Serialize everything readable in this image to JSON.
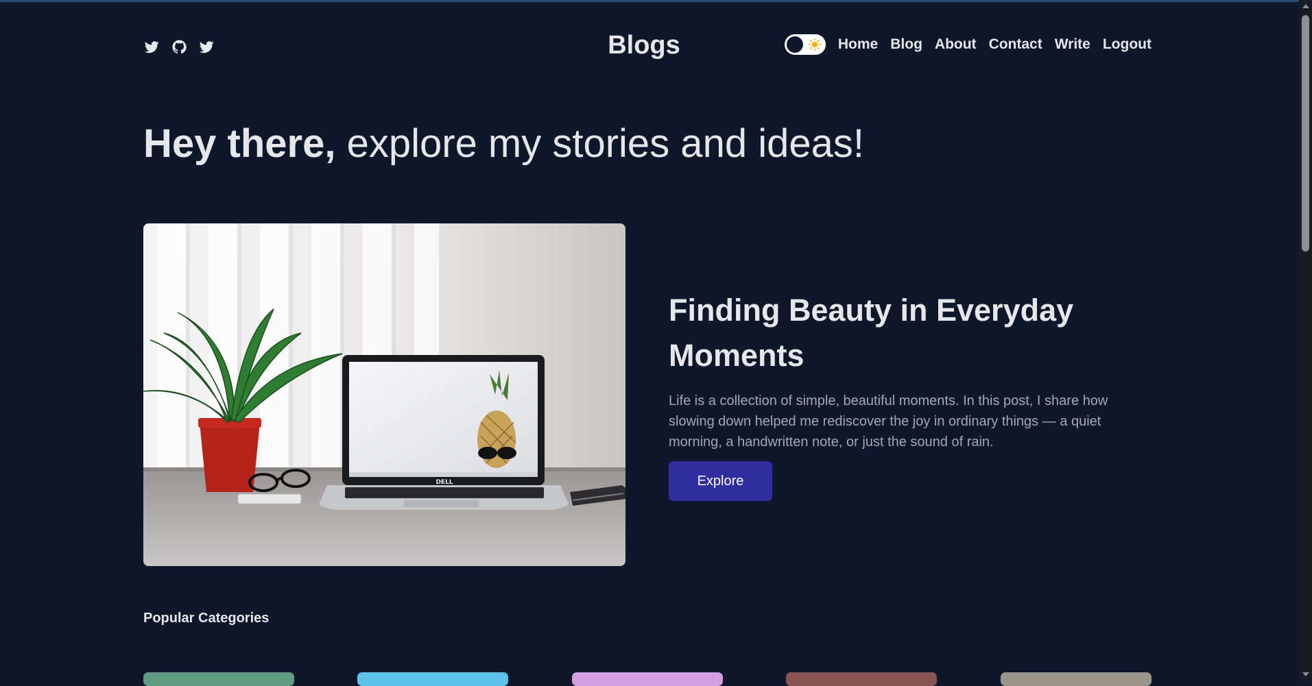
{
  "header": {
    "brand": "Blogs",
    "socials": [
      "twitter-icon",
      "github-icon",
      "twitter-icon"
    ],
    "theme_toggle": {
      "state": "dark",
      "icon": "sun-icon"
    },
    "nav": [
      {
        "label": "Home"
      },
      {
        "label": "Blog"
      },
      {
        "label": "About"
      },
      {
        "label": "Contact"
      },
      {
        "label": "Write"
      },
      {
        "label": "Logout"
      }
    ]
  },
  "hero": {
    "bold": "Hey there,",
    "light": "explore my stories and ideas!"
  },
  "featured": {
    "title": "Finding Beauty in Everyday Moments",
    "description": "Life is a collection of simple, beautiful moments. In this post, I share how slowing down helped me rediscover the joy in ordinary things — a quiet morning, a handwritten note, or just the sound of rain.",
    "button": "Explore",
    "laptop_brand": "DELL"
  },
  "categories": {
    "title": "Popular Categories",
    "colors": [
      "#5f9c81",
      "#5bc4e8",
      "#d39ee0",
      "#8a5353",
      "#9a9589"
    ]
  },
  "colors": {
    "background": "#0f172a",
    "accent": "#312e9f",
    "text": "#e5e7eb",
    "muted": "#a3a8b3"
  }
}
